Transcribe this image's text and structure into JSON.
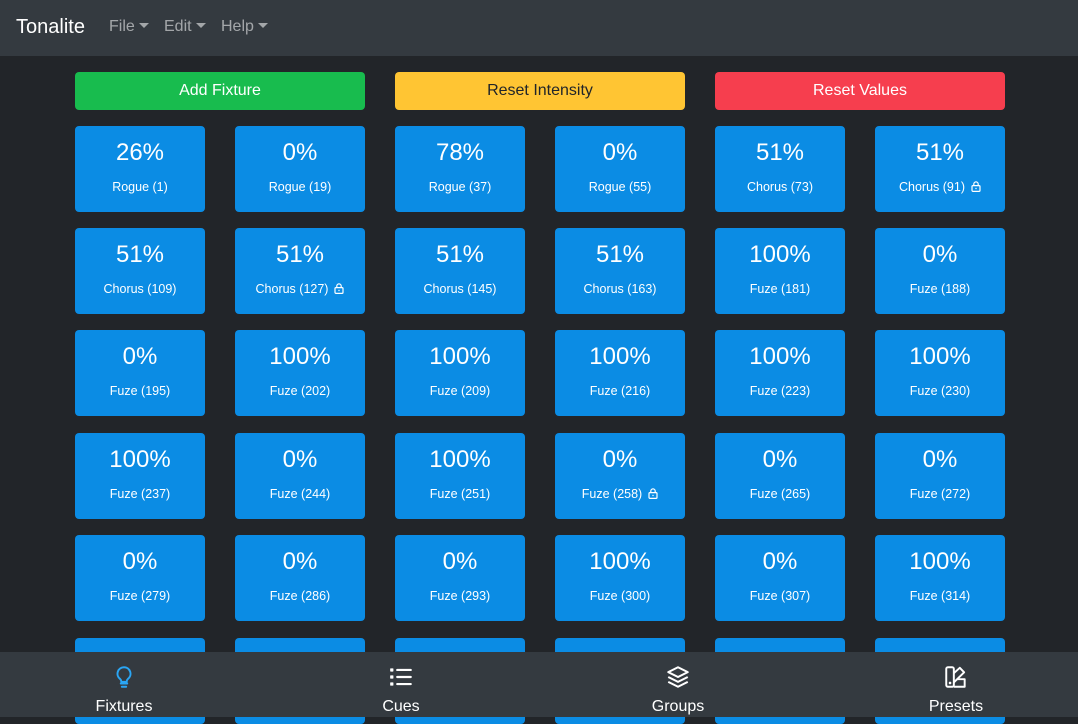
{
  "app": {
    "title": "Tonalite",
    "menus": [
      {
        "label": "File"
      },
      {
        "label": "Edit"
      },
      {
        "label": "Help"
      }
    ]
  },
  "actions": [
    {
      "label": "Add Fixture",
      "color": "#18bc4e",
      "text_color": "#ffffff"
    },
    {
      "label": "Reset Intensity",
      "color": "#ffc533",
      "text_color": "#212529"
    },
    {
      "label": "Reset Values",
      "color": "#f63e4e",
      "text_color": "#ffffff"
    }
  ],
  "fixtures": [
    {
      "intensity": "26%",
      "name": "Rogue (1)",
      "locked": false
    },
    {
      "intensity": "0%",
      "name": "Rogue (19)",
      "locked": false
    },
    {
      "intensity": "78%",
      "name": "Rogue (37)",
      "locked": false
    },
    {
      "intensity": "0%",
      "name": "Rogue (55)",
      "locked": false
    },
    {
      "intensity": "51%",
      "name": "Chorus (73)",
      "locked": false
    },
    {
      "intensity": "51%",
      "name": "Chorus (91)",
      "locked": true
    },
    {
      "intensity": "51%",
      "name": "Chorus (109)",
      "locked": false
    },
    {
      "intensity": "51%",
      "name": "Chorus (127)",
      "locked": true
    },
    {
      "intensity": "51%",
      "name": "Chorus (145)",
      "locked": false
    },
    {
      "intensity": "51%",
      "name": "Chorus (163)",
      "locked": false
    },
    {
      "intensity": "100%",
      "name": "Fuze (181)",
      "locked": false
    },
    {
      "intensity": "0%",
      "name": "Fuze (188)",
      "locked": false
    },
    {
      "intensity": "0%",
      "name": "Fuze (195)",
      "locked": false
    },
    {
      "intensity": "100%",
      "name": "Fuze (202)",
      "locked": false
    },
    {
      "intensity": "100%",
      "name": "Fuze (209)",
      "locked": false
    },
    {
      "intensity": "100%",
      "name": "Fuze (216)",
      "locked": false
    },
    {
      "intensity": "100%",
      "name": "Fuze (223)",
      "locked": false
    },
    {
      "intensity": "100%",
      "name": "Fuze (230)",
      "locked": false
    },
    {
      "intensity": "100%",
      "name": "Fuze (237)",
      "locked": false
    },
    {
      "intensity": "0%",
      "name": "Fuze (244)",
      "locked": false
    },
    {
      "intensity": "100%",
      "name": "Fuze (251)",
      "locked": false
    },
    {
      "intensity": "0%",
      "name": "Fuze (258)",
      "locked": true
    },
    {
      "intensity": "0%",
      "name": "Fuze (265)",
      "locked": false
    },
    {
      "intensity": "0%",
      "name": "Fuze (272)",
      "locked": false
    },
    {
      "intensity": "0%",
      "name": "Fuze (279)",
      "locked": false
    },
    {
      "intensity": "0%",
      "name": "Fuze (286)",
      "locked": false
    },
    {
      "intensity": "0%",
      "name": "Fuze (293)",
      "locked": false
    },
    {
      "intensity": "100%",
      "name": "Fuze (300)",
      "locked": false
    },
    {
      "intensity": "0%",
      "name": "Fuze (307)",
      "locked": false
    },
    {
      "intensity": "100%",
      "name": "Fuze (314)",
      "locked": false
    },
    {
      "intensity": "",
      "name": "",
      "locked": false
    },
    {
      "intensity": "",
      "name": "",
      "locked": false
    },
    {
      "intensity": "",
      "name": "",
      "locked": false
    },
    {
      "intensity": "",
      "name": "",
      "locked": false
    },
    {
      "intensity": "",
      "name": "",
      "locked": false
    },
    {
      "intensity": "",
      "name": "",
      "locked": false
    }
  ],
  "bottom_nav": [
    {
      "label": "Fixtures",
      "icon": "lightbulb-icon",
      "active": true
    },
    {
      "label": "Cues",
      "icon": "list-icon",
      "active": false
    },
    {
      "label": "Groups",
      "icon": "layers-icon",
      "active": false
    },
    {
      "label": "Presets",
      "icon": "palette-icon",
      "active": false
    }
  ],
  "colors": {
    "background": "#222529",
    "navbar": "#343a40",
    "tile": "#0b8ce4",
    "active_icon": "#2aa6f5"
  }
}
